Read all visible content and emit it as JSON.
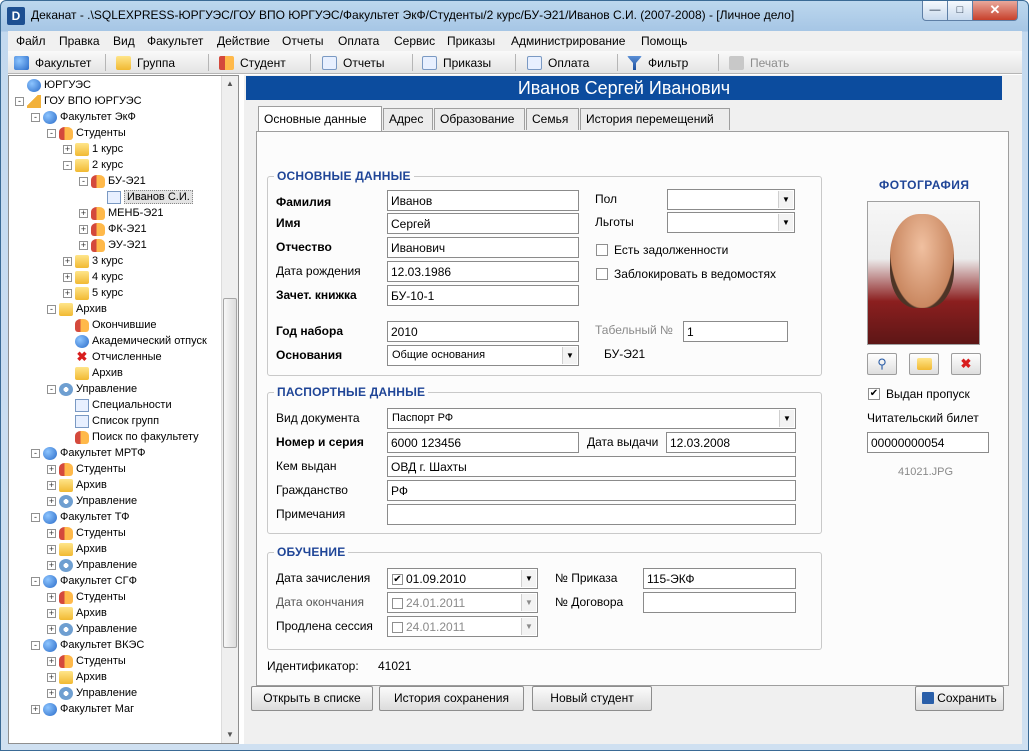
{
  "window": {
    "title": "Деканат - .\\SQLEXPRESS-ЮРГУЭС/ГОУ ВПО ЮРГУЭС/Факультет ЭкФ/Студенты/2 курс/БУ-Э21/Иванов С.И. (2007-2008) - [Личное дело]",
    "app_icon_letter": "D"
  },
  "menu": [
    "Файл",
    "Правка",
    "Вид",
    "Факультет",
    "Действие",
    "Отчеты",
    "Оплата",
    "Сервис",
    "Приказы",
    "Администрирование",
    "Помощь"
  ],
  "toolbar": {
    "faculty": "Факультет",
    "group": "Группа",
    "student": "Студент",
    "reports": "Отчеты",
    "orders": "Приказы",
    "payment": "Оплата",
    "filter": "Фильтр",
    "print": "Печать"
  },
  "tree": [
    {
      "label": "ЮРГУЭС",
      "level": 0,
      "icon": "globe",
      "box": ""
    },
    {
      "label": "ГОУ ВПО ЮРГУЭС",
      "level": 0,
      "icon": "house",
      "box": "-"
    },
    {
      "label": "Факультет ЭкФ",
      "level": 1,
      "icon": "globe",
      "box": "-"
    },
    {
      "label": "Студенты",
      "level": 2,
      "icon": "people",
      "box": "-"
    },
    {
      "label": "1 курс",
      "level": 3,
      "icon": "folder",
      "box": "+"
    },
    {
      "label": "2 курс",
      "level": 3,
      "icon": "folder",
      "box": "-"
    },
    {
      "label": "БУ-Э21",
      "level": 4,
      "icon": "people",
      "box": "-"
    },
    {
      "label": "Иванов С.И.",
      "level": 5,
      "icon": "doc",
      "box": "",
      "selected": true
    },
    {
      "label": "МЕНБ-Э21",
      "level": 4,
      "icon": "people",
      "box": "+"
    },
    {
      "label": "ФК-Э21",
      "level": 4,
      "icon": "people",
      "box": "+"
    },
    {
      "label": "ЭУ-Э21",
      "level": 4,
      "icon": "people",
      "box": "+"
    },
    {
      "label": "3 курс",
      "level": 3,
      "icon": "folder",
      "box": "+"
    },
    {
      "label": "4 курс",
      "level": 3,
      "icon": "folder",
      "box": "+"
    },
    {
      "label": "5 курс",
      "level": 3,
      "icon": "folder",
      "box": "+"
    },
    {
      "label": "Архив",
      "level": 2,
      "icon": "folder",
      "box": "-"
    },
    {
      "label": "Окончившие",
      "level": 3,
      "icon": "people",
      "box": ""
    },
    {
      "label": "Академический отпуск",
      "level": 3,
      "icon": "globe",
      "box": ""
    },
    {
      "label": "Отчисленные",
      "level": 3,
      "icon": "redx",
      "box": ""
    },
    {
      "label": "Архив",
      "level": 3,
      "icon": "folder",
      "box": ""
    },
    {
      "label": "Управление",
      "level": 2,
      "icon": "gear",
      "box": "-"
    },
    {
      "label": "Специальности",
      "level": 3,
      "icon": "doc",
      "box": ""
    },
    {
      "label": "Список групп",
      "level": 3,
      "icon": "doc",
      "box": ""
    },
    {
      "label": "Поиск по факультету",
      "level": 3,
      "icon": "people",
      "box": ""
    },
    {
      "label": "Факультет МРТФ",
      "level": 1,
      "icon": "globe",
      "box": "-"
    },
    {
      "label": "Студенты",
      "level": 2,
      "icon": "people",
      "box": "+"
    },
    {
      "label": "Архив",
      "level": 2,
      "icon": "folder",
      "box": "+"
    },
    {
      "label": "Управление",
      "level": 2,
      "icon": "gear",
      "box": "+"
    },
    {
      "label": "Факультет ТФ",
      "level": 1,
      "icon": "globe",
      "box": "-"
    },
    {
      "label": "Студенты",
      "level": 2,
      "icon": "people",
      "box": "+"
    },
    {
      "label": "Архив",
      "level": 2,
      "icon": "folder",
      "box": "+"
    },
    {
      "label": "Управление",
      "level": 2,
      "icon": "gear",
      "box": "+"
    },
    {
      "label": "Факультет СГФ",
      "level": 1,
      "icon": "globe",
      "box": "-"
    },
    {
      "label": "Студенты",
      "level": 2,
      "icon": "people",
      "box": "+"
    },
    {
      "label": "Архив",
      "level": 2,
      "icon": "folder",
      "box": "+"
    },
    {
      "label": "Управление",
      "level": 2,
      "icon": "gear",
      "box": "+"
    },
    {
      "label": "Факультет ВКЭС",
      "level": 1,
      "icon": "globe",
      "box": "-"
    },
    {
      "label": "Студенты",
      "level": 2,
      "icon": "people",
      "box": "+"
    },
    {
      "label": "Архив",
      "level": 2,
      "icon": "folder",
      "box": "+"
    },
    {
      "label": "Управление",
      "level": 2,
      "icon": "gear",
      "box": "+"
    },
    {
      "label": "Факультет Маг",
      "level": 1,
      "icon": "globe",
      "box": "+"
    }
  ],
  "header": {
    "student_name": "Иванов Сергей Иванович"
  },
  "tabs": [
    "Основные данные",
    "Адрес",
    "Образование",
    "Семья",
    "История перемещений"
  ],
  "basic": {
    "section": "ОСНОВНЫЕ ДАННЫЕ",
    "surname_label": "Фамилия",
    "surname": "Иванов",
    "name_label": "Имя",
    "name": "Сергей",
    "patronymic_label": "Отчество",
    "patronymic": "Иванович",
    "birth_label": "Дата рождения",
    "birth": "12.03.1986",
    "record_label": "Зачет. книжка",
    "record": "БУ-10-1",
    "sex_label": "Пол",
    "sex": "",
    "benefits_label": "Льготы",
    "benefits": "",
    "debt_label": "Есть задолженности",
    "debt_checked": false,
    "block_label": "Заблокировать в ведомостях",
    "block_checked": false,
    "year_label": "Год набора",
    "year": "2010",
    "tab_label": "Табельный №",
    "tab": "1",
    "basis_label": "Основания",
    "basis": "Общие основания",
    "group_code": "БУ-Э21"
  },
  "photo": {
    "title": "ФОТОГРАФИЯ",
    "pass_label": "Выдан пропуск",
    "pass_checked": true,
    "library_label": "Читательский билет",
    "library": "00000000054",
    "filename": "41021.JPG"
  },
  "passport": {
    "section": "ПАСПОРТНЫЕ ДАННЫЕ",
    "doc_label": "Вид документа",
    "doc": "Паспорт РФ",
    "number_label": "Номер и серия",
    "number": "6000 123456",
    "issued_date_label": "Дата выдачи",
    "issued_date": "12.03.2008",
    "issued_by_label": "Кем выдан",
    "issued_by": "ОВД г. Шахты",
    "citizenship_label": "Гражданство",
    "citizenship": "РФ",
    "notes_label": "Примечания",
    "notes": ""
  },
  "study": {
    "section": "ОБУЧЕНИЕ",
    "enroll_label": "Дата зачисления",
    "enroll": "01.09.2010",
    "enroll_checked": true,
    "end_label": "Дата окончания",
    "end": "24.01.2011",
    "end_checked": false,
    "ext_label": "Продлена сессия",
    "ext": "24.01.2011",
    "ext_checked": false,
    "order_label": "№ Приказа",
    "order": "115-ЭКФ",
    "contract_label": "№ Договора",
    "contract": ""
  },
  "id": {
    "label": "Идентификатор:",
    "value": "41021"
  },
  "buttons": {
    "open_list": "Открыть в списке",
    "history": "История сохранения",
    "new_student": "Новый студент",
    "save": "Сохранить"
  }
}
